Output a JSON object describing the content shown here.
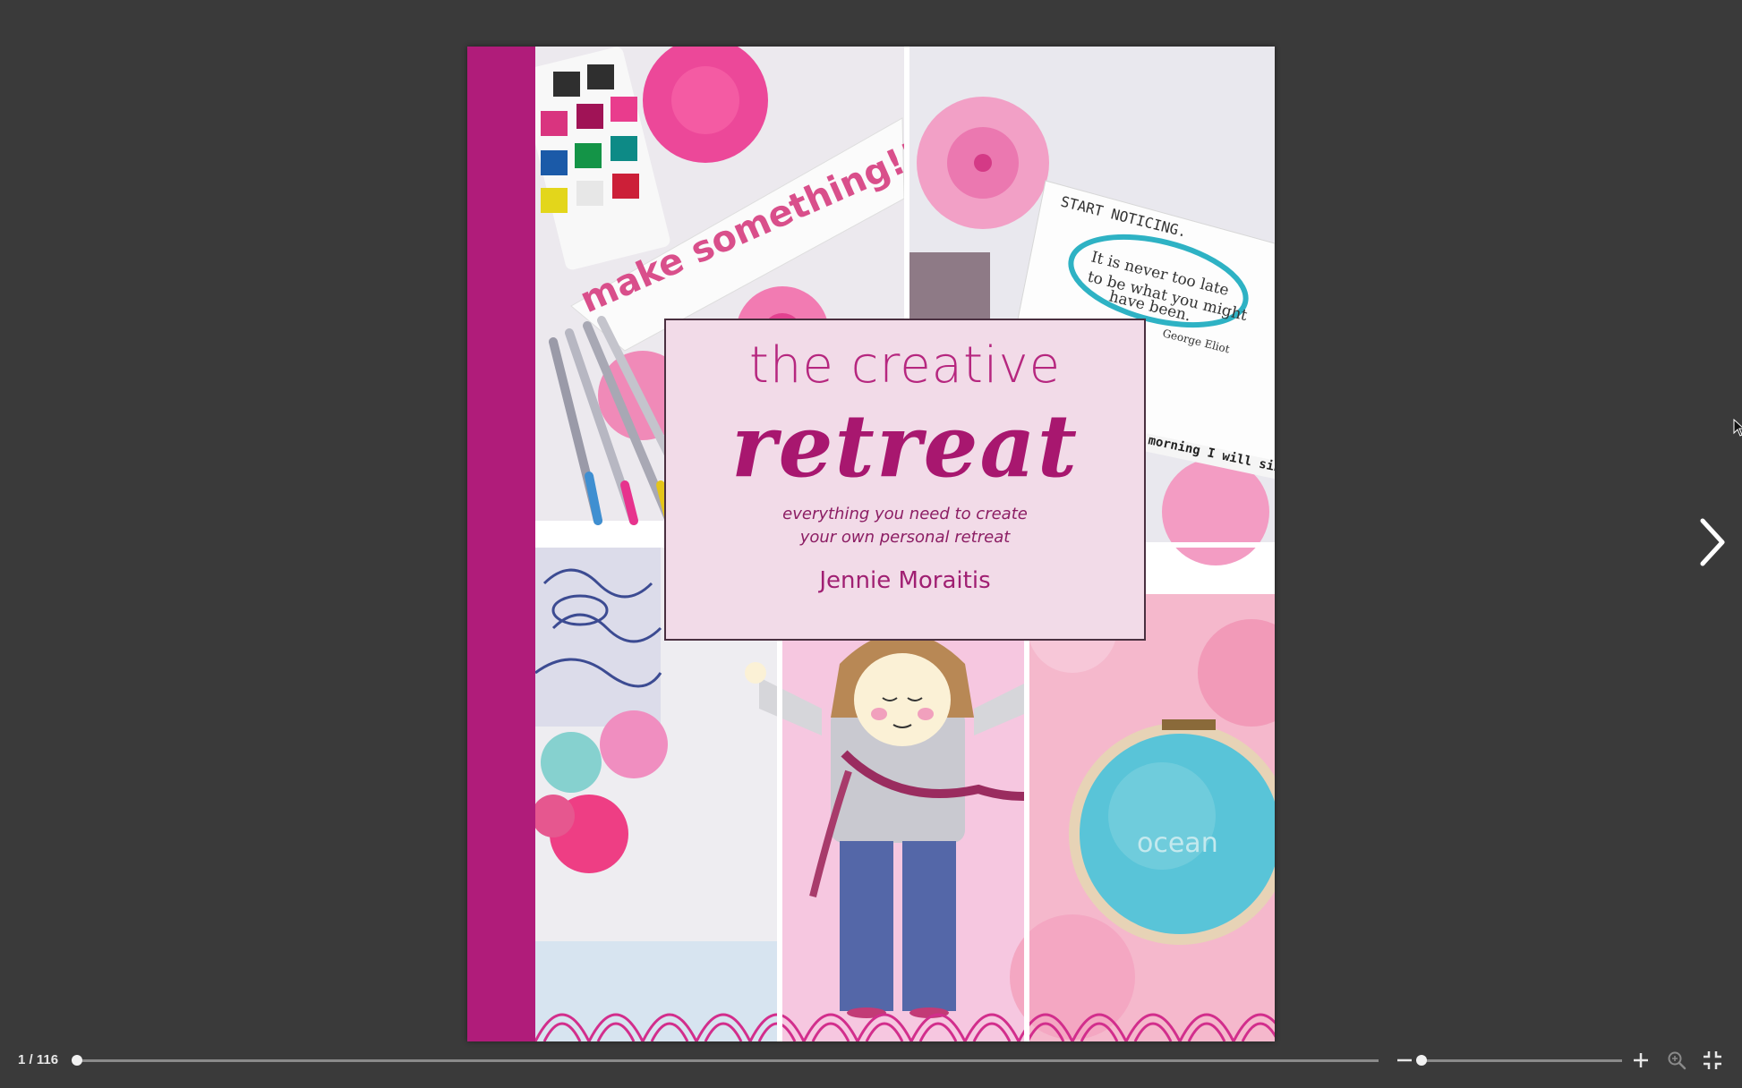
{
  "viewer": {
    "current_page": 1,
    "total_pages": 116,
    "page_counter": "1 / 116",
    "zoom_level": 0.0
  },
  "book": {
    "title_line1": "the creative",
    "title_line2": "retreat",
    "subtitle_line1": "everything you need to create",
    "subtitle_line2": "your own personal retreat",
    "author": "Jennie Moraitis",
    "photo_texts": {
      "make_something": "make something!!",
      "start_noticing": "START NOTICING.",
      "quote": "It is never too late to be what you might have been.",
      "quote_author": "George Eliot",
      "sing": "morning I will sing",
      "ocean": "ocean"
    }
  },
  "icons": {
    "next": "chevron-right-icon",
    "zoom_out": "minus-icon",
    "zoom_in": "plus-icon",
    "search": "zoom-search-icon",
    "fullscreen": "exit-fullscreen-icon"
  },
  "colors": {
    "background": "#3a3a3a",
    "spine": "#b01c7a",
    "title": "#a8176f",
    "title_box": "#f2dbe8"
  }
}
